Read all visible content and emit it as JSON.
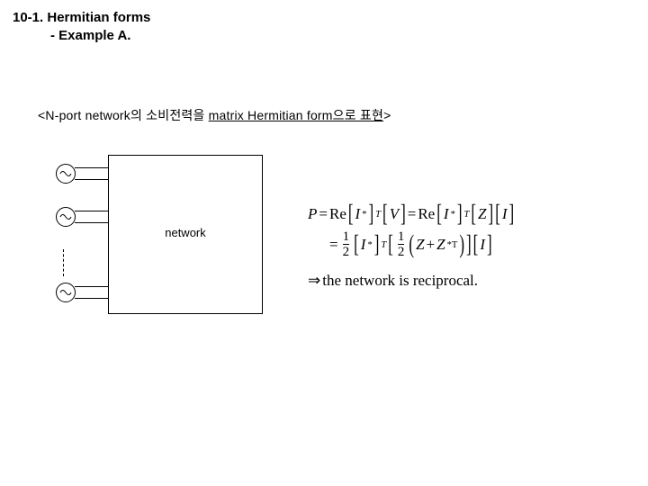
{
  "title": {
    "line1": "10-1. Hermitian forms",
    "line2": "- Example A."
  },
  "subhead": {
    "open": "<",
    "p1": "N-port network의 소비전력을 ",
    "p2": "matrix Hermitian form으로 표현",
    "close": ">"
  },
  "diagram": {
    "network_label": "network"
  },
  "eq": {
    "P": "P",
    "eq": " = ",
    "Re": "Re",
    "I": "I",
    "star": "*",
    "T": "T",
    "V": "V",
    "Z": "Z",
    "half_num": "1",
    "half_den": "2",
    "plus": " + ",
    "starT": "*T",
    "arrow": "⇒ ",
    "concl": "the network is reciprocal."
  }
}
